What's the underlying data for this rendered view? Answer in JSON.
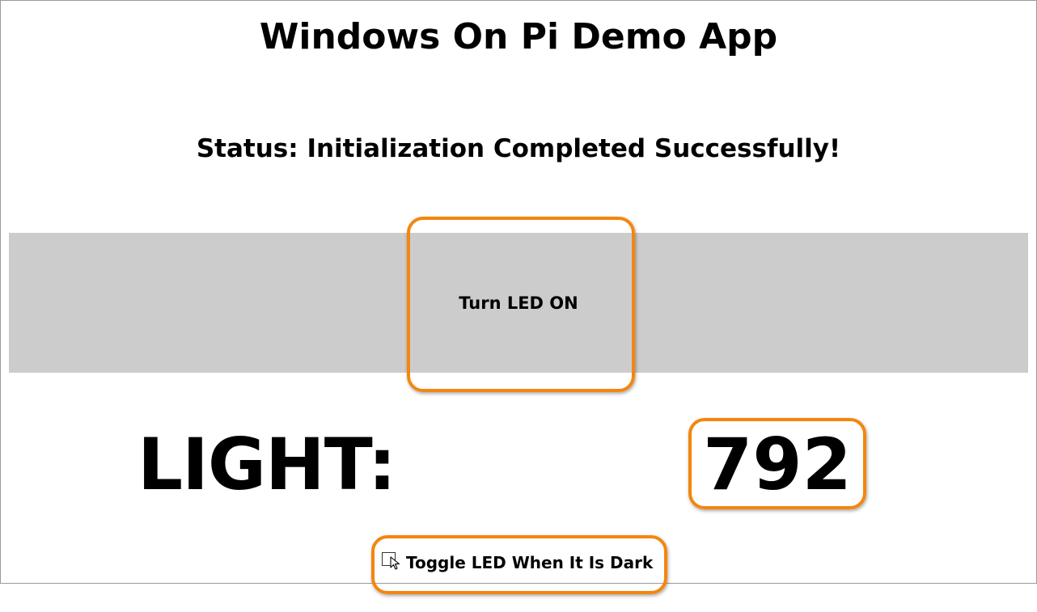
{
  "app": {
    "title": "Windows On Pi Demo App",
    "status": "Status: Initialization Completed Successfully!"
  },
  "led_button": {
    "label": "Turn LED ON"
  },
  "light": {
    "label": "LIGHT:",
    "value": "792"
  },
  "toggle": {
    "label": "Toggle LED When It Is Dark",
    "checked": false
  },
  "colors": {
    "highlight": "#f4860e",
    "button_background": "#cccccc",
    "text": "#000000",
    "background": "#ffffff"
  },
  "icons": {
    "toggle_checkbox": "checkbox-icon",
    "pointer": "mouse-pointer-icon"
  }
}
